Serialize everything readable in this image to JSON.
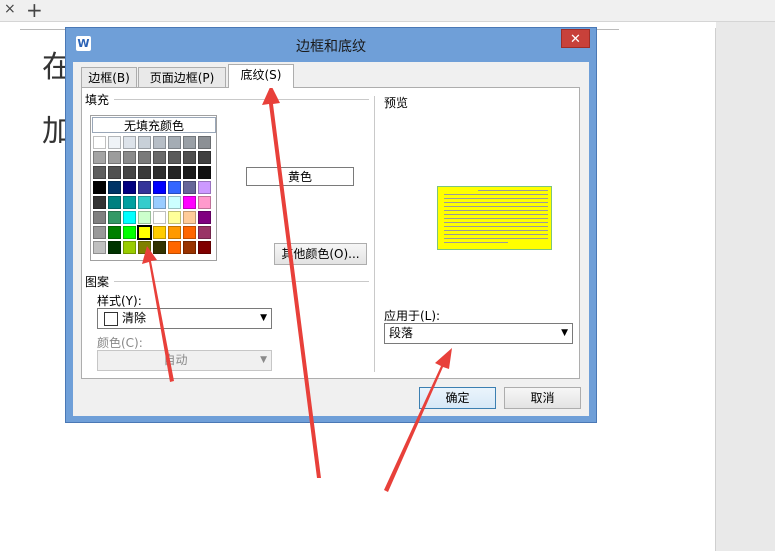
{
  "browser": {
    "close_glyph": "×",
    "new_tab_glyph": "+"
  },
  "document": {
    "text_line1": "在",
    "text_line2": "加"
  },
  "dialog": {
    "app_icon": "W",
    "title": "边框和底纹",
    "close_glyph": "✕",
    "tabs": [
      {
        "label": "边框(B)"
      },
      {
        "label": "页面边框(P)"
      },
      {
        "label": "底纹(S)"
      }
    ],
    "fill": {
      "group_label": "填充",
      "no_fill_label": "无填充颜色",
      "selected_color_name": "黄色",
      "more_colors_label": "其他颜色(O)...",
      "colors": [
        "#ffffff",
        "#eff3f7",
        "#dde3ea",
        "#c8d0d8",
        "#b7bec6",
        "#a4acb4",
        "#9aa0a6",
        "#8c9095",
        "#a5a5a5",
        "#9c9c9c",
        "#8b8b8b",
        "#7a7a7a",
        "#6a6a6a",
        "#5a5a5a",
        "#4f4f4f",
        "#3f3f3f",
        "#5e5e5e",
        "#505050",
        "#454545",
        "#3a3a3a",
        "#2e2e2e",
        "#232323",
        "#1a1a1a",
        "#101010",
        "#000000",
        "#003366",
        "#000080",
        "#333399",
        "#0000ff",
        "#3366ff",
        "#666699",
        "#cc99ff",
        "#333333",
        "#008080",
        "#00a0a0",
        "#33cccc",
        "#99ccff",
        "#ccffff",
        "#ff00ff",
        "#ff99cc",
        "#808080",
        "#339966",
        "#00ffff",
        "#ccffcc",
        "#ffffff",
        "#ffff99",
        "#ffcc99",
        "#800080",
        "#999999",
        "#008000",
        "#00ff00",
        "#ffff00",
        "#ffcc00",
        "#ff9900",
        "#ff6600",
        "#993366",
        "#c0c0c0",
        "#003300",
        "#99cc00",
        "#808000",
        "#333300",
        "#ff6600",
        "#993300",
        "#800000"
      ],
      "selected_index": 51
    },
    "pattern": {
      "group_label": "图案",
      "style_label": "样式(Y):",
      "style_value": "清除",
      "color_label": "颜色(C):",
      "color_value": "自动"
    },
    "preview": {
      "label": "预览",
      "fill_color": "#ffff00"
    },
    "apply_to": {
      "label": "应用于(L):",
      "value": "段落"
    },
    "ok_label": "确定",
    "cancel_label": "取消",
    "dropdown_arrow": "▼"
  },
  "annotation_color": "#e8403a"
}
